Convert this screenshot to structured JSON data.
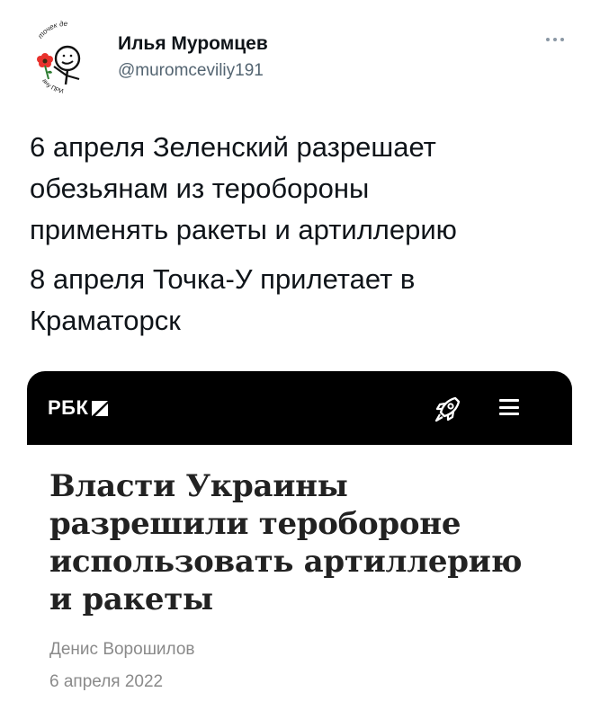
{
  "tweet": {
    "author_name": "Илья Муромцев",
    "author_handle": "@muromceviliy191",
    "paragraphs": [
      "6 апреля Зеленский разрешает\nобезьянам из теробороны\nприменять ракеты и артиллерию",
      "8 апреля Точка-У прилетает в\nКраматорск"
    ]
  },
  "avatar": {
    "top_text": "точек де",
    "bottom_text": "ану ПРИ"
  },
  "card": {
    "brand_name": "РБК",
    "headline": "Власти Украины разрешили теробороне использовать артиллерию и ракеты",
    "author": "Денис Ворошилов",
    "date": "6 апреля 2022"
  },
  "icons": {
    "more": "more-dots-icon",
    "rocket": "rocket-icon",
    "menu": "hamburger-menu-icon",
    "logo_mark": "rbk-slash-mark-icon"
  },
  "colors": {
    "text": "#0f1419",
    "secondary": "#536471",
    "card_header": "#000000",
    "card_meta": "#8a8a8a",
    "flower": "#e8322d"
  }
}
